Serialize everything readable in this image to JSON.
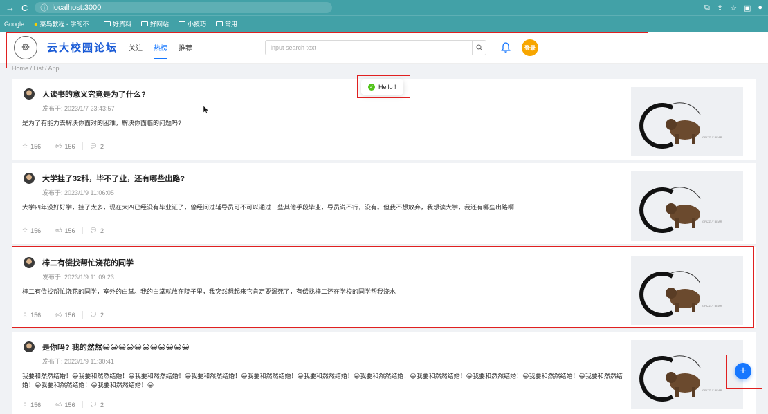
{
  "browser": {
    "url": "localhost:3000",
    "bookmarks": [
      "Google",
      "菜鸟教程 - 学的不...",
      "好资料",
      "好网站",
      "小技巧",
      "常用"
    ]
  },
  "header": {
    "brand": "云大校园论坛",
    "tabs": [
      {
        "label": "关注",
        "active": false
      },
      {
        "label": "热榜",
        "active": true
      },
      {
        "label": "推荐",
        "active": false
      }
    ],
    "search_placeholder": "input search text",
    "login_label": "登录",
    "accent": "#1677ff",
    "login_color": "#f7a600"
  },
  "breadcrumb": "Home / List / App",
  "toast": {
    "message": "Hello !"
  },
  "posts": [
    {
      "title": "人读书的意义究竟是为了什么?",
      "time": "发布于: 2023/1/7 23:43:57",
      "excerpt": "是为了有能力去解决你面对的困难，解决你面临的问题吗?",
      "stars": "156",
      "likes": "156",
      "comments": "2"
    },
    {
      "title": "大学挂了32科，毕不了业，还有哪些出路?",
      "time": "发布于: 2023/1/9 11:06:05",
      "excerpt": "大学四年没好好学，挂了太多，现在大四已经没有毕业证了，曾经问过辅导员可不可以通过一些其他手段毕业，导员说不行，没有。但我不想放弃，我想读大学，我还有哪些出路啊",
      "stars": "156",
      "likes": "156",
      "comments": "2"
    },
    {
      "title": "梓二有偿找帮忙浇花的同学",
      "time": "发布于: 2023/1/9 11:09:23",
      "excerpt": "梓二有偿找帮忙浇花的同学，室外的白掌。我的白掌就放在院子里，我突然想起来它肯定要渴死了，有偿找梓二还在学校的同学帮我浇水",
      "stars": "156",
      "likes": "156",
      "comments": "2"
    },
    {
      "title": "是你吗? 我的然然😀😀😀😀😀😀😀😀😀😀😀",
      "time": "发布于: 2023/1/9 11:30:41",
      "excerpt": "我要和然然结婚！😀我要和然然结婚！😀我要和然然结婚！😀我要和然然结婚！😀我要和然然结婚！😀我要和然然结婚！😀我要和然然结婚！😀我要和然然结婚！😀我要和然然结婚！😀我要和然然结婚！😀我要和然然结婚！😀我要和然然结婚！😀我要和然然结婚！😀",
      "stars": "156",
      "likes": "156",
      "comments": "2"
    }
  ],
  "thumb_text": "GRIZZLY BEAR"
}
